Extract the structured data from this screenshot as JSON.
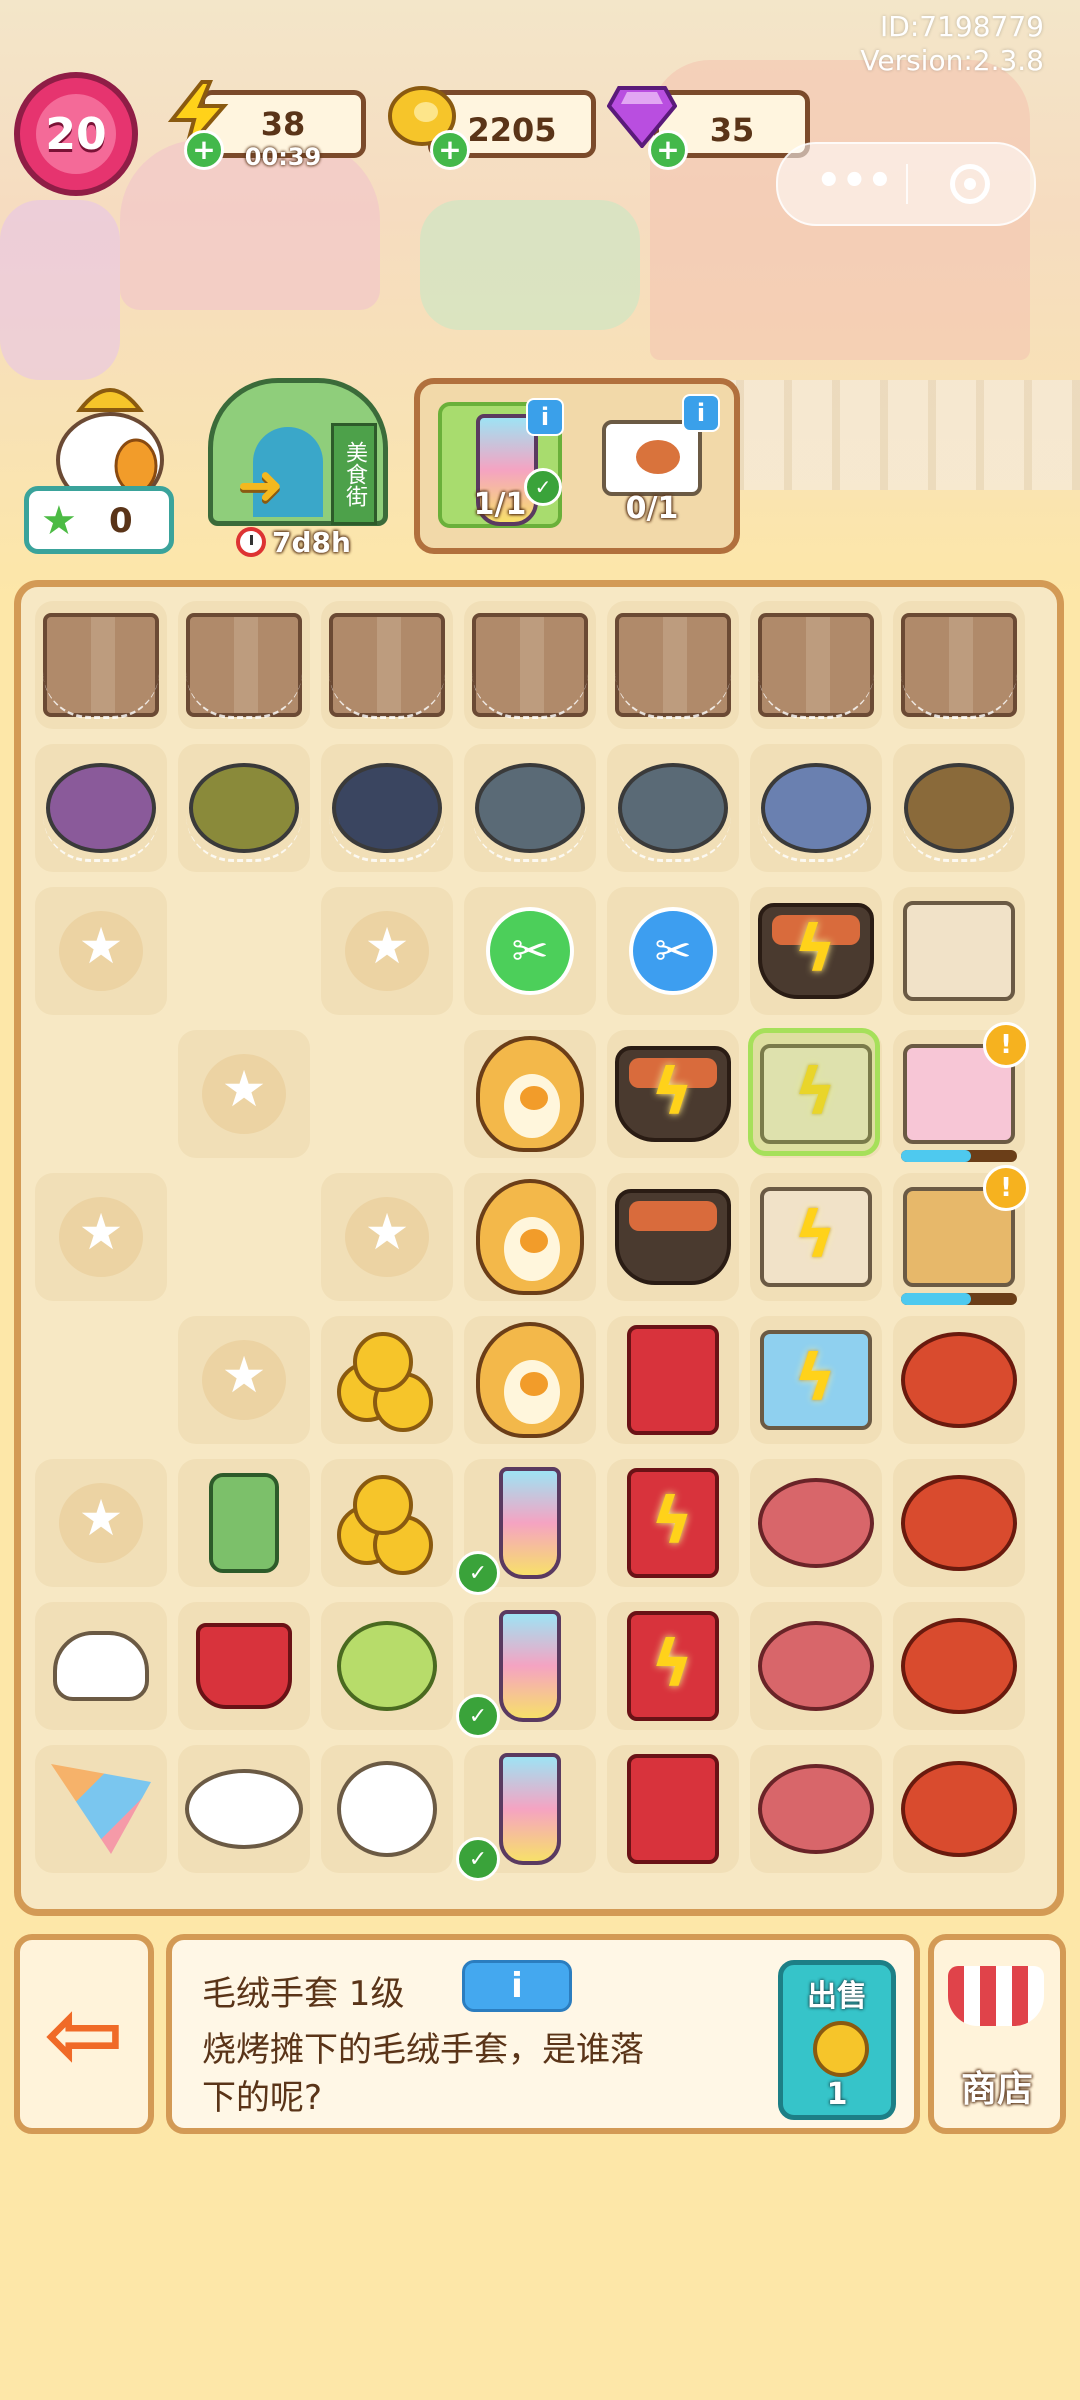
{
  "hud": {
    "user_id": "ID:7198779",
    "version": "Version:2.3.8",
    "level": "20",
    "energy": "38",
    "energy_timer": "00:39",
    "coins": "2205",
    "gems": "35"
  },
  "star_counter": "0",
  "event": {
    "sign": "美食街",
    "timer": "7d8h"
  },
  "orders": [
    {
      "progress": "1/1",
      "completed": true,
      "icon": "rainbow-drink-icon"
    },
    {
      "progress": "0/1",
      "completed": false,
      "icon": "takeout-box-icon"
    }
  ],
  "board": {
    "columns": 7,
    "rows": 9,
    "grid": [
      [
        "box",
        "box",
        "box",
        "box",
        "box",
        "box",
        "box"
      ],
      [
        "pot-purple",
        "pot-green",
        "pot-dark",
        "pot-stack",
        "pot-stack",
        "pot-blue",
        "pot-taco"
      ],
      [
        "star",
        "empty",
        "star",
        "scissors-green",
        "scissors-blue",
        "grill-bolt",
        "cart-boxes"
      ],
      [
        "empty",
        "star",
        "empty",
        "tiger",
        "grill-bolt",
        "cart-bolt",
        "icecream-truck"
      ],
      [
        "star",
        "empty",
        "star",
        "tiger",
        "grill",
        "cart-bolt",
        "food-truck"
      ],
      [
        "empty",
        "star",
        "coins-stack",
        "tiger",
        "fridge-cactus",
        "truck-bolt",
        "lobster"
      ],
      [
        "star",
        "gas-can",
        "coins",
        "drink",
        "fridge-cactus-bolt",
        "steak",
        "lobster"
      ],
      [
        "glove",
        "bucket",
        "fruits",
        "drink",
        "fridge-cactus-bolt",
        "steak",
        "lobster"
      ],
      [
        "flags",
        "plate-egg",
        "keys-duck",
        "drink",
        "fridge-open",
        "steak",
        "lobster"
      ]
    ]
  },
  "selected_item": {
    "name": "毛绒手套 1级",
    "info_label": "i",
    "description": "烧烤摊下的毛绒手套，是谁落下的呢?",
    "sell_label": "出售",
    "sell_price": "1"
  },
  "shop_label": "商店",
  "colors": {
    "board_border": "#d39a55",
    "accent_blue": "#44a8ef",
    "sell_teal": "#36c4c9"
  }
}
